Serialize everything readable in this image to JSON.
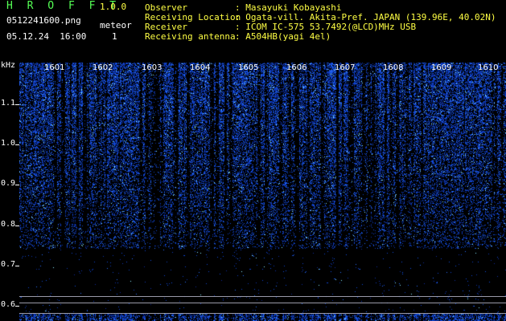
{
  "header": {
    "app_title": "H R O F F T",
    "app_version": "1.0.0",
    "file_name": "0512241600.png",
    "meteor_label": "meteor",
    "datetime": "05.12.24  16:00",
    "meteor_count": "1",
    "fields": [
      {
        "label": "Observer",
        "value": ": Masayuki Kobayashi"
      },
      {
        "label": "Receiving Location",
        "value": ": Ogata-vill. Akita-Pref. JAPAN (139.96E, 40.02N)"
      },
      {
        "label": "Receiver",
        "value": ": ICOM IC-575 53.7492(@LCD)MHz USB"
      },
      {
        "label": "Receiving antenna",
        "value": ": A504HB(yagi 4el)"
      }
    ]
  },
  "axis": {
    "unit": "kHz",
    "y_labels": [
      "1.1",
      "1.0",
      "0.9",
      "0.8",
      "0.7",
      "0.6"
    ],
    "minute_labels": [
      "1601",
      "1602",
      "1603",
      "1604",
      "1605",
      "1606",
      "1607",
      "1608",
      "1609",
      "1610"
    ]
  },
  "colors": {
    "background": "#000000",
    "signal_dense": "#1a3cff",
    "signal_hot": "#9ff0ff",
    "text": "#ffffff",
    "title": "#ffff44"
  }
}
